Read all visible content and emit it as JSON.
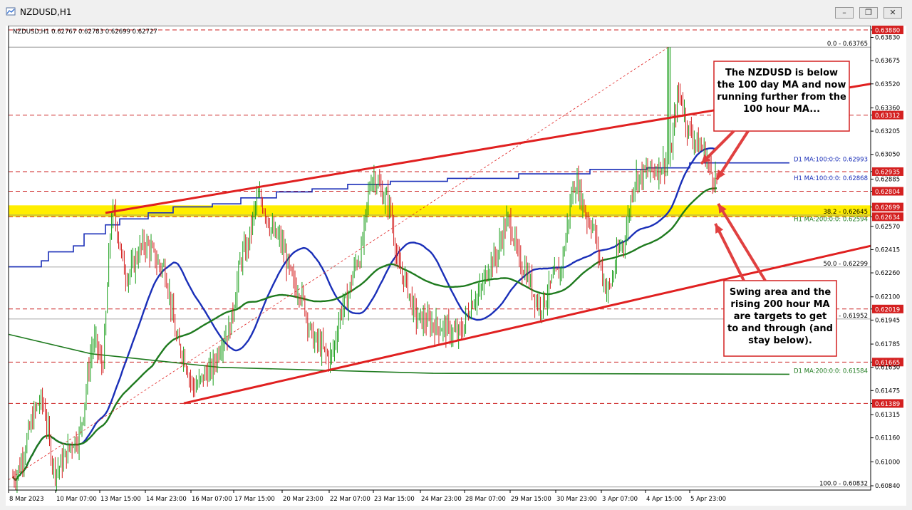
{
  "window": {
    "title": "NZDUSD,H1"
  },
  "window_controls": [
    "minimize-icon",
    "restore-icon",
    "close-icon"
  ],
  "chart_data": {
    "type": "candlestick",
    "symbol_header": "NZDUSD,H1  0.62767 0.62783 0.62699 0.62727",
    "y_ticks": [
      "0.63880",
      "0.63830",
      "0.63675",
      "0.63520",
      "0.63360",
      "0.63312",
      "0.63205",
      "0.63050",
      "0.62935",
      "0.62885",
      "0.62804",
      "0.62699",
      "0.62634",
      "0.62570",
      "0.62415",
      "0.62260",
      "0.62100",
      "0.62019",
      "0.61945",
      "0.61785",
      "0.61665",
      "0.61630",
      "0.61475",
      "0.61389",
      "0.61315",
      "0.61160",
      "0.61000",
      "0.60840"
    ],
    "x_ticks": [
      "8 Mar 2023",
      "10 Mar 07:00",
      "13 Mar 15:00",
      "14 Mar 23:00",
      "16 Mar 07:00",
      "17 Mar 15:00",
      "20 Mar 23:00",
      "22 Mar 07:00",
      "23 Mar 15:00",
      "24 Mar 23:00",
      "28 Mar 07:00",
      "29 Mar 15:00",
      "30 Mar 23:00",
      "3 Apr 07:00",
      "4 Apr 15:00",
      "5 Apr 23:00"
    ],
    "hlines": [
      {
        "price": 0.6388,
        "label": "0.63880",
        "style": "dashed",
        "color": "#cc2222"
      },
      {
        "price": 0.63312,
        "label": "0.63312",
        "style": "dashed",
        "color": "#cc2222"
      },
      {
        "price": 0.62935,
        "label": "0.62935",
        "style": "dashed",
        "color": "#cc2222"
      },
      {
        "price": 0.62804,
        "label": "0.62804",
        "style": "dashed",
        "color": "#cc2222"
      },
      {
        "price": 0.62634,
        "label": "0.62634",
        "style": "dashed",
        "color": "#cc2222"
      },
      {
        "price": 0.62019,
        "label": "0.62019",
        "style": "dashed",
        "color": "#cc2222"
      },
      {
        "price": 0.61665,
        "label": "0.61665",
        "style": "dashed",
        "color": "#cc2222"
      },
      {
        "price": 0.61389,
        "label": "0.61389",
        "style": "dashed",
        "color": "#cc2222"
      }
    ],
    "current_price": {
      "price": 0.62699,
      "label": "0.62699"
    },
    "fib_levels": [
      {
        "price": 0.63765,
        "label": "0.0 - 0.63765"
      },
      {
        "price": 0.62645,
        "label": "38.2 - 0.62645"
      },
      {
        "price": 0.62299,
        "label": "50.0 - 0.62299"
      },
      {
        "price": 0.61952,
        "label": ".8 - 0.61952"
      },
      {
        "price": 0.60832,
        "label": "100.0 - 0.60832"
      }
    ],
    "ma_labels": {
      "d1_100": "D1 MA:100:0:0: 0.62993",
      "h1_100": "H1 MA:100:0:0: 0.62868",
      "h1_200": "H1 MA:200:0:0: 0.62594",
      "d1_200": "D1 MA:200:0:0: 0.61584"
    },
    "swing_zone": {
      "top": 0.6271,
      "bottom": 0.62634
    },
    "annotations": [
      {
        "lines": [
          "The NZDUSD is below",
          "the 100 day MA and now",
          "running further from the",
          "100 hour MA..."
        ]
      },
      {
        "lines": [
          "Swing area and the",
          "rising 200 hour MA",
          "are targets to get",
          "to and through (and",
          "stay below)."
        ]
      }
    ],
    "colors": {
      "up": "#1a9e1a",
      "down": "#d42020",
      "ma100": "#1a2fb8",
      "ma200": "#1e7a1e",
      "trend": "#e02020",
      "zone": "#ffee00"
    }
  }
}
